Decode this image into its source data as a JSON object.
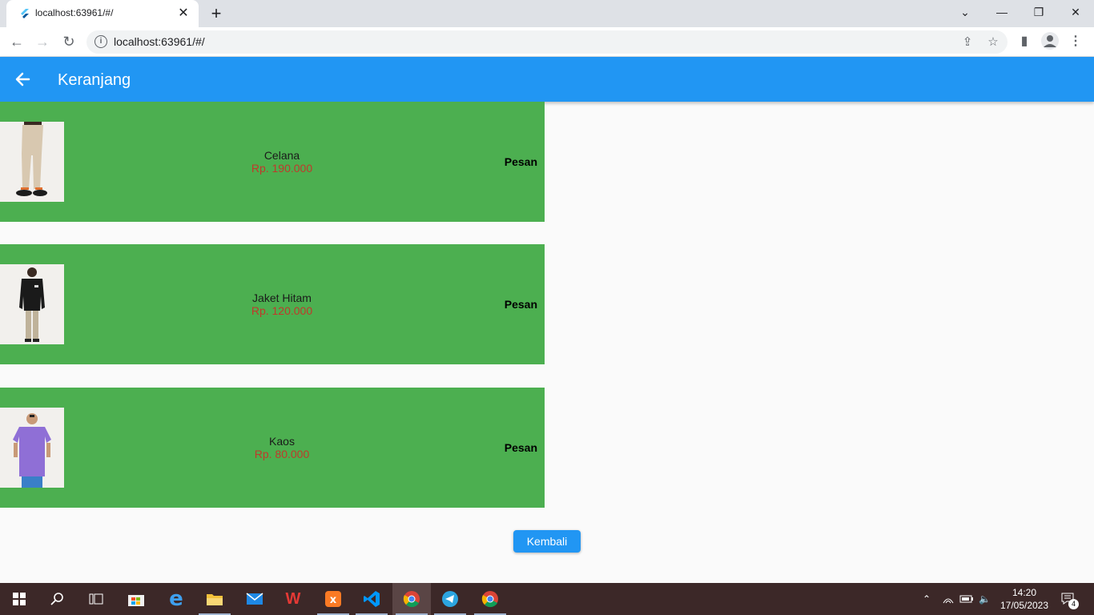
{
  "browser": {
    "tab_title": "localhost:63961/#/",
    "url": "localhost:63961/#/",
    "new_tab_label": "+",
    "close_tab_label": "✕"
  },
  "app": {
    "title": "Keranjang",
    "colors": {
      "appbar": "#2196f3",
      "item_bg": "#4caf50",
      "price": "#c0392b"
    },
    "items": [
      {
        "name": "Celana",
        "price": "Rp. 190.000",
        "action": "Pesan",
        "image": "pants-photo"
      },
      {
        "name": "Jaket Hitam",
        "price": "Rp. 120.000",
        "action": "Pesan",
        "image": "black-jacket-photo"
      },
      {
        "name": "Kaos",
        "price": "Rp. 80.000",
        "action": "Pesan",
        "image": "purple-tshirt-photo"
      }
    ],
    "back_button_label": "Kembali"
  },
  "taskbar": {
    "time": "14:20",
    "date": "17/05/2023",
    "notification_count": "4"
  }
}
